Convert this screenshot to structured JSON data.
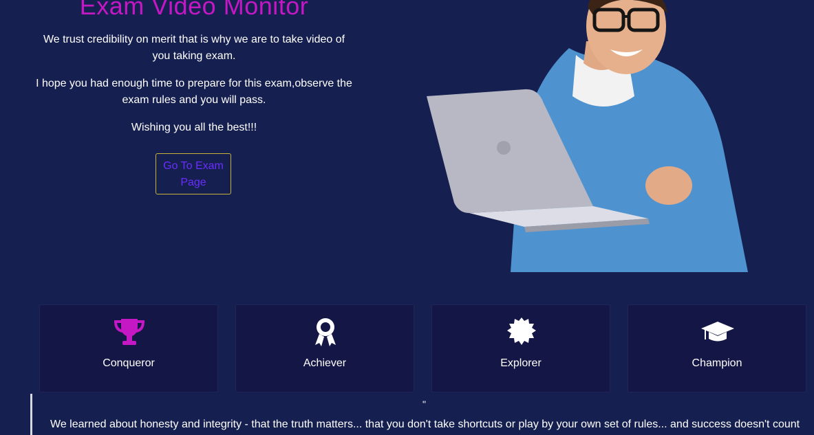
{
  "hero": {
    "title": "Exam Video Monitor",
    "paragraph_1": "We trust credibility on merit that is why we are to take video of you taking exam.",
    "paragraph_2": "I hope you had enough time to prepare for this exam,observe the exam rules and you will pass.",
    "paragraph_3": "Wishing you all the best!!!",
    "cta_label": "Go To Exam Page"
  },
  "cards": [
    {
      "label": "Conqueror",
      "icon": "trophy-icon"
    },
    {
      "label": "Achiever",
      "icon": "award-ribbon-icon"
    },
    {
      "label": "Explorer",
      "icon": "certificate-badge-icon"
    },
    {
      "label": "Champion",
      "icon": "graduation-cap-icon"
    }
  ],
  "quote": {
    "mark": "\"",
    "text": "We learned about honesty and integrity - that the truth matters... that you don't take shortcuts or play by your own set of rules... and success doesn't count"
  },
  "colors": {
    "background": "#162050",
    "title": "#c518c5",
    "card_background": "#141645",
    "icon": "#ffffff",
    "cta_text": "#6a2dff",
    "cta_border": "#c7b23a"
  }
}
